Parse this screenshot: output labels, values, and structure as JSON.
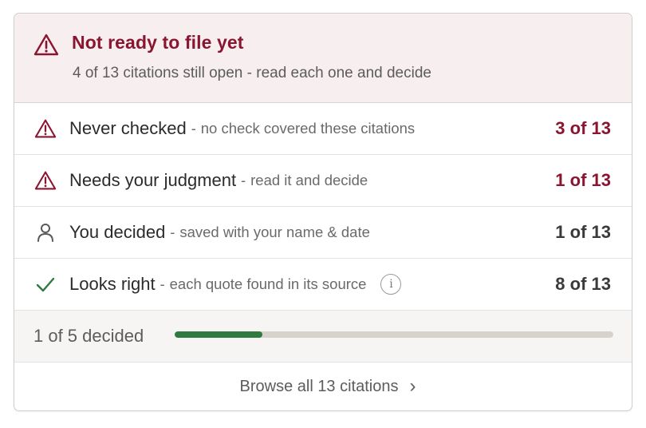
{
  "alert": {
    "title": "Not ready to file yet",
    "subtitle": "4 of 13 citations still open - read each one and decide",
    "icon": "warning-triangle-icon"
  },
  "rows": [
    {
      "label": "Never checked",
      "separator": "-",
      "description": "no check covered these citations",
      "count": "3 of 13",
      "icon": "warning-triangle-icon",
      "status_color": "#8a1530"
    },
    {
      "label": "Needs your judgment",
      "separator": "-",
      "description": "read it and decide",
      "count": "1 of 13",
      "icon": "warning-triangle-icon",
      "status_color": "#8a1530"
    },
    {
      "label": "You decided",
      "separator": "-",
      "description": "saved with your name & date",
      "count": "1 of 13",
      "icon": "person-icon",
      "status_color": "#3a3a3a"
    },
    {
      "label": "Looks right",
      "separator": "-",
      "description": "each quote found in its source",
      "count": "8 of 13",
      "icon": "checkmark-icon",
      "status_color": "#2f7a3f",
      "info_glyph": "i"
    }
  ],
  "progress": {
    "label": "1 of 5 decided",
    "fraction": 0.2,
    "fill_color": "#2f7a3f"
  },
  "browse": {
    "label": "Browse all 13 citations",
    "chevron": "›"
  }
}
